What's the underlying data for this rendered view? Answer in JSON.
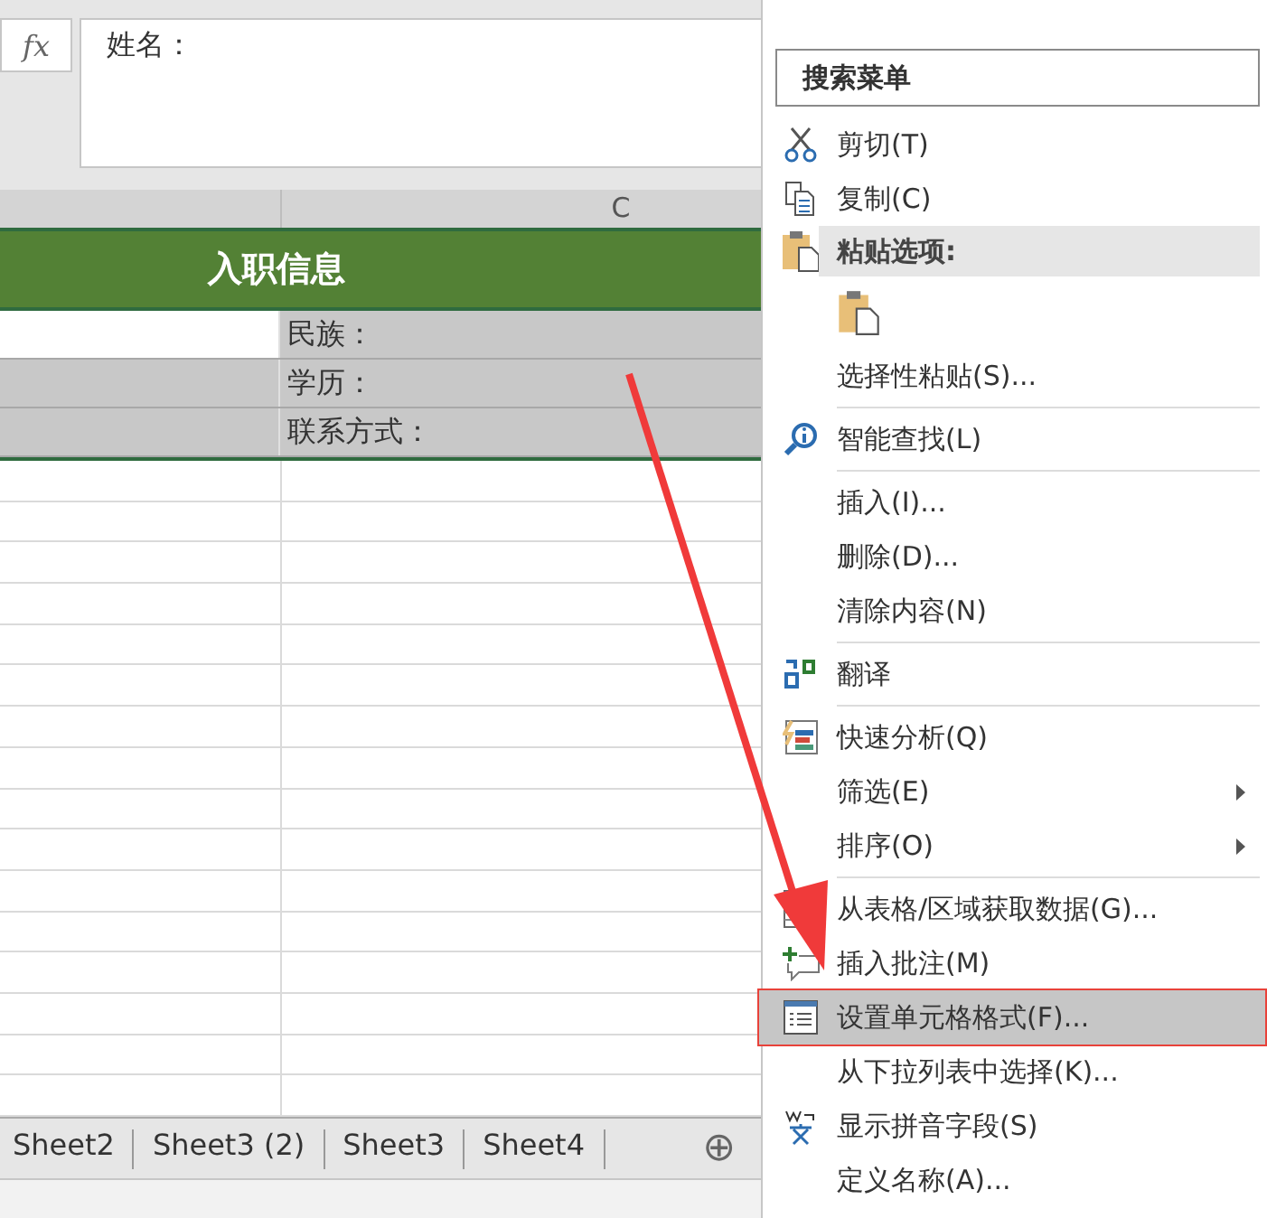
{
  "formula_bar": {
    "fx": "fx",
    "value": "姓名："
  },
  "column_headers": [
    "C"
  ],
  "header_band": {
    "title": "入职信息"
  },
  "rows": [
    {
      "column_c": "民族：",
      "active": true
    },
    {
      "column_c": "学历：",
      "active": false
    },
    {
      "column_c": "联系方式：",
      "active": false
    }
  ],
  "sheet_tabs": [
    {
      "label": "Sheet2",
      "selected": false
    },
    {
      "label": "Sheet3 (2)",
      "selected": false
    },
    {
      "label": "Sheet3",
      "selected": false
    },
    {
      "label": "Sheet4",
      "selected": false
    }
  ],
  "add_sheet": "⊕",
  "context_menu": {
    "search_placeholder": "搜索菜单",
    "items": [
      {
        "kind": "item",
        "label": "剪切(T)",
        "submenu": false,
        "selected": false
      },
      {
        "kind": "item",
        "label": "复制(C)",
        "submenu": false,
        "selected": false
      },
      {
        "kind": "header",
        "label": "粘贴选项:"
      },
      {
        "kind": "paste"
      },
      {
        "kind": "item",
        "label": "选择性粘贴(S)...",
        "submenu": false,
        "selected": false
      },
      {
        "kind": "separator"
      },
      {
        "kind": "item",
        "label": "智能查找(L)",
        "submenu": false,
        "selected": false
      },
      {
        "kind": "separator"
      },
      {
        "kind": "item",
        "label": "插入(I)...",
        "submenu": false,
        "selected": false
      },
      {
        "kind": "item",
        "label": "删除(D)...",
        "submenu": false,
        "selected": false
      },
      {
        "kind": "item",
        "label": "清除内容(N)",
        "submenu": false,
        "selected": false
      },
      {
        "kind": "separator"
      },
      {
        "kind": "item",
        "label": "翻译",
        "submenu": false,
        "selected": false
      },
      {
        "kind": "separator"
      },
      {
        "kind": "item",
        "label": "快速分析(Q)",
        "submenu": false,
        "selected": false
      },
      {
        "kind": "item",
        "label": "筛选(E)",
        "submenu": true,
        "selected": false
      },
      {
        "kind": "item",
        "label": "排序(O)",
        "submenu": true,
        "selected": false
      },
      {
        "kind": "separator"
      },
      {
        "kind": "item",
        "label": "从表格/区域获取数据(G)...",
        "submenu": false,
        "selected": false
      },
      {
        "kind": "item",
        "label": "插入批注(M)",
        "submenu": false,
        "selected": false
      },
      {
        "kind": "item",
        "label": "设置单元格格式(F)...",
        "submenu": false,
        "selected": true
      },
      {
        "kind": "item",
        "label": "从下拉列表中选择(K)...",
        "submenu": false,
        "selected": false
      },
      {
        "kind": "item",
        "label": "显示拼音字段(S)",
        "submenu": false,
        "selected": false
      },
      {
        "kind": "item",
        "label": "定义名称(A)...",
        "submenu": false,
        "selected": false
      }
    ]
  }
}
